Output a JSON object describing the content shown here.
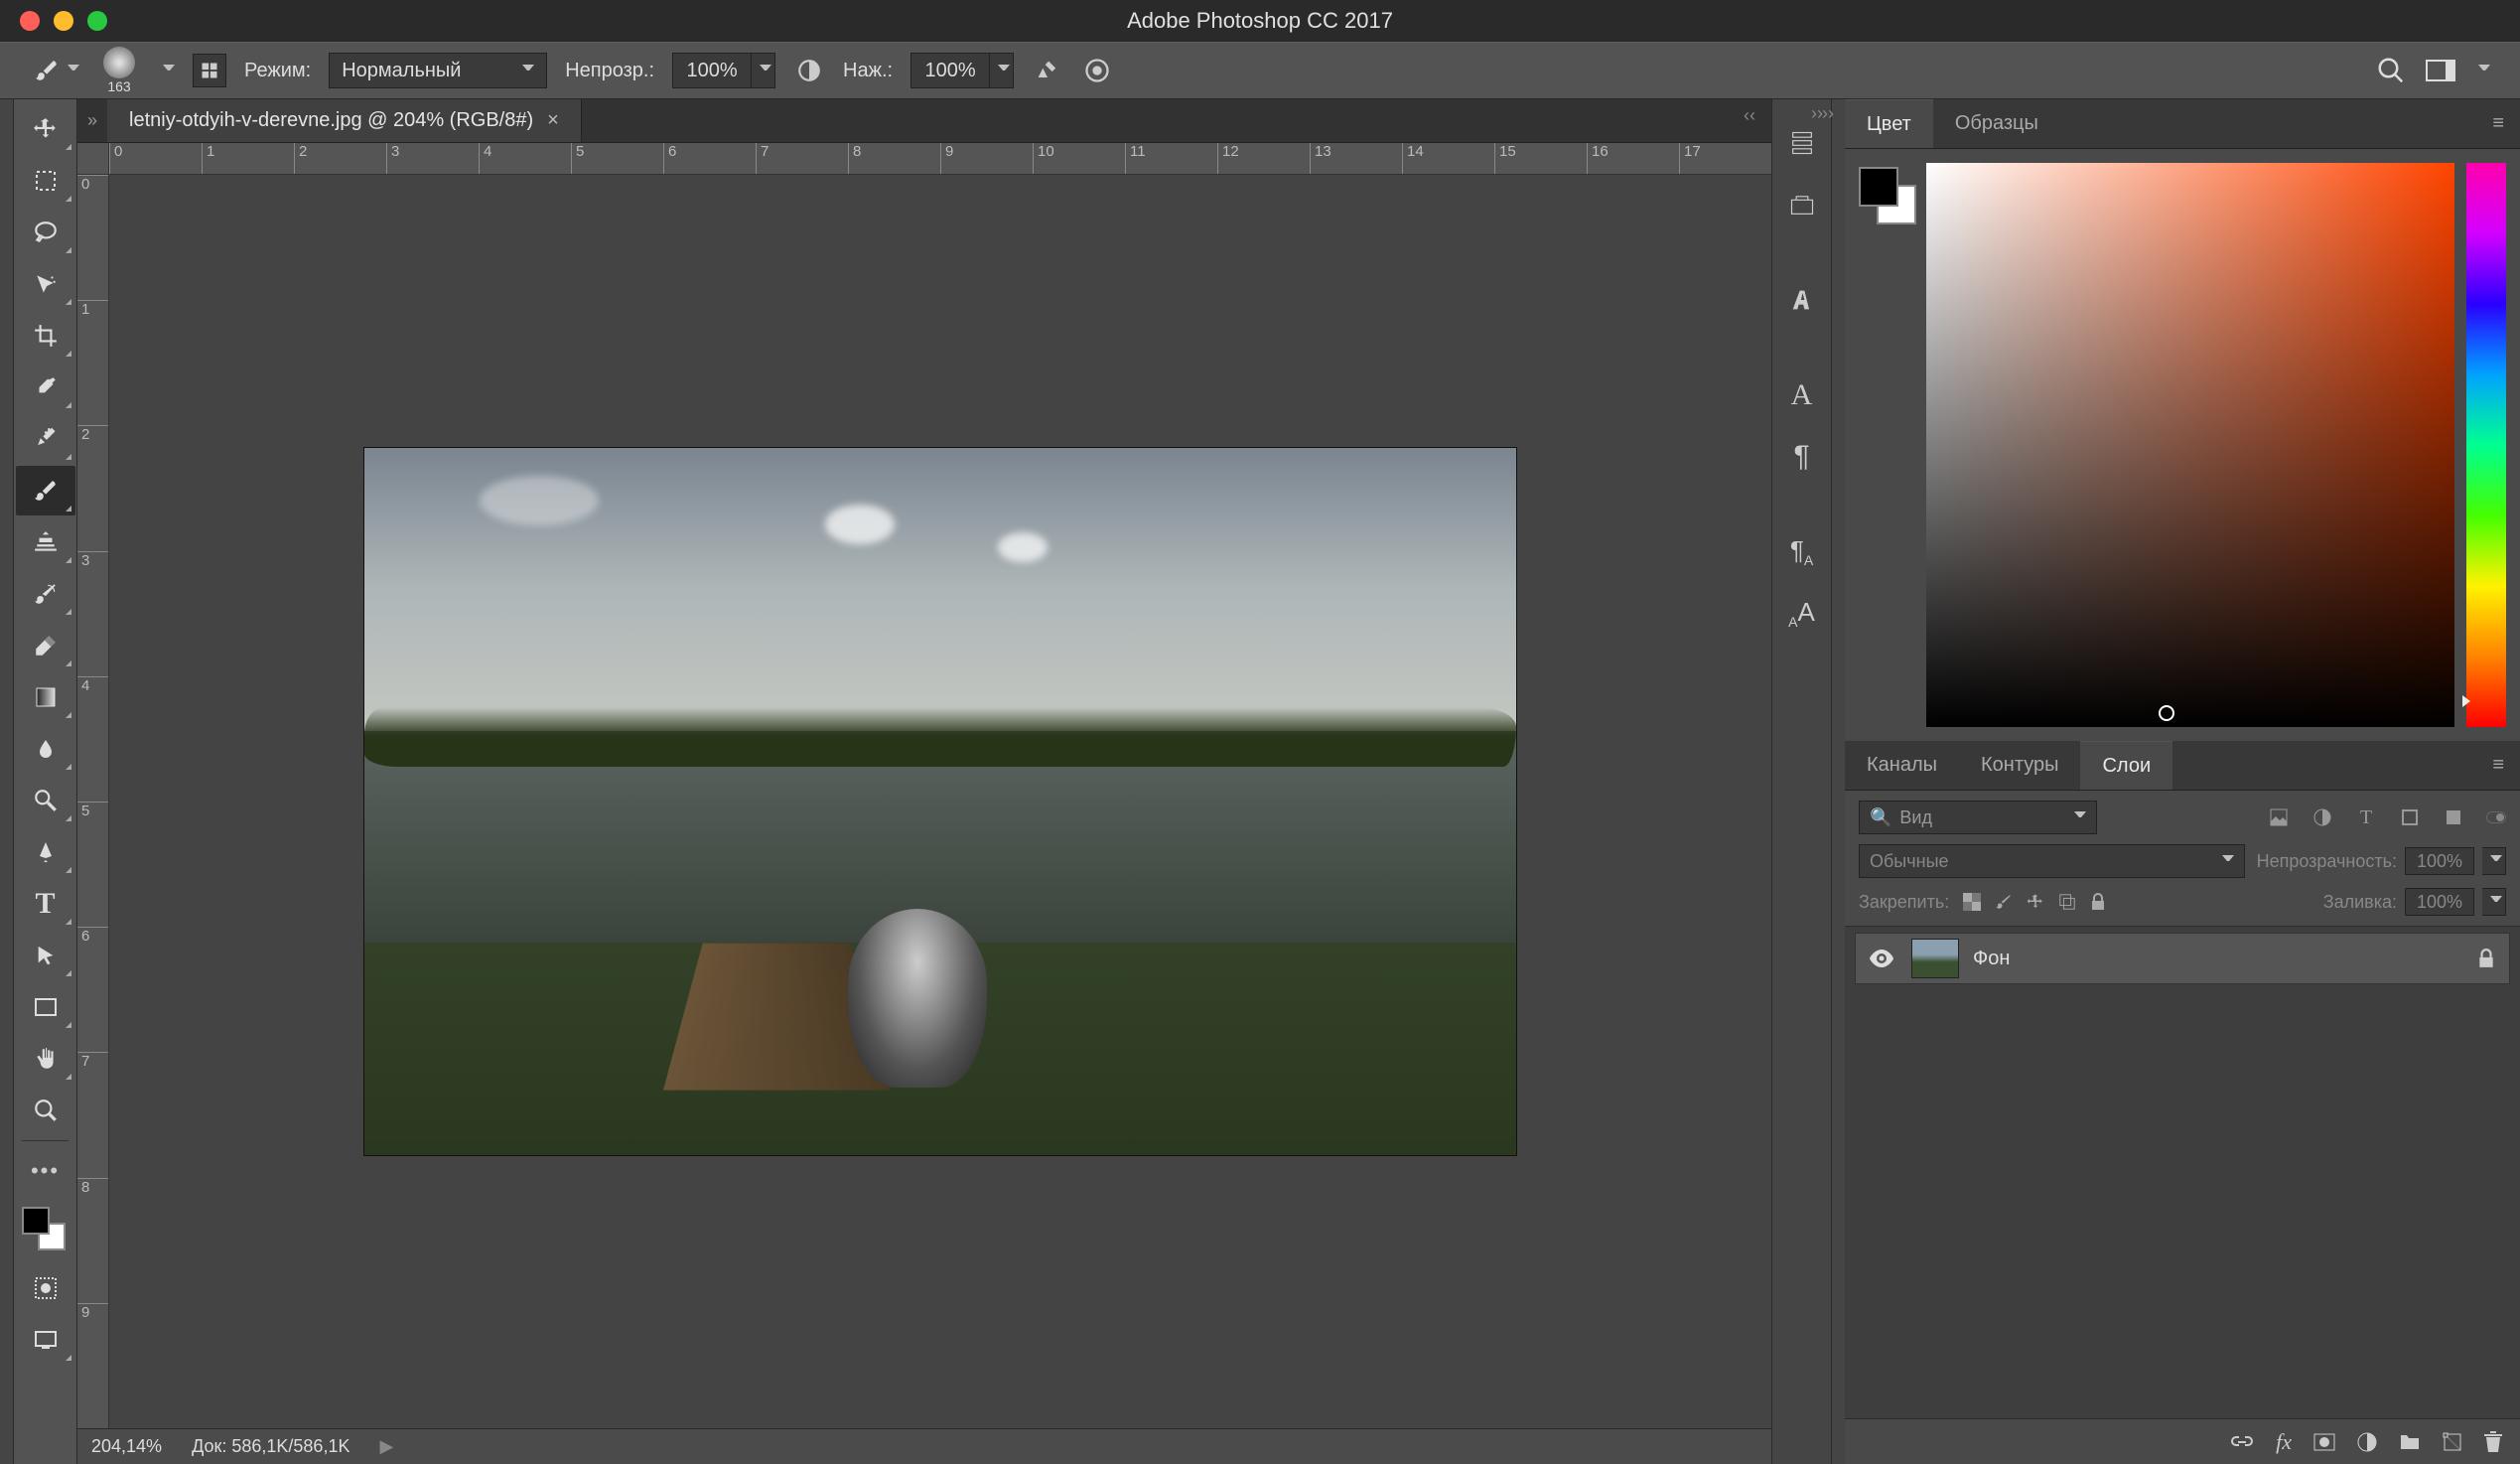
{
  "app_title": "Adobe Photoshop CC 2017",
  "options_bar": {
    "brush_size": "163",
    "mode_label": "Режим:",
    "mode_value": "Нормальный",
    "opacity_label": "Непрозр.:",
    "opacity_value": "100%",
    "flow_label": "Наж.:",
    "flow_value": "100%"
  },
  "document": {
    "tab_title": "letniy-otdyih-v-derevne.jpg @ 204% (RGB/8#)",
    "zoom": "204,14%",
    "doc_info_label": "Док:",
    "doc_info_value": "586,1K/586,1K"
  },
  "ruler_h": [
    "0",
    "1",
    "2",
    "3",
    "4",
    "5",
    "6",
    "7",
    "8",
    "9",
    "10",
    "11",
    "12",
    "13",
    "14",
    "15",
    "16",
    "17"
  ],
  "ruler_v": [
    "0",
    "1",
    "2",
    "3",
    "4",
    "5",
    "6",
    "7",
    "8",
    "9"
  ],
  "color_panel": {
    "tab_color": "Цвет",
    "tab_swatches": "Образцы"
  },
  "layers_panel": {
    "tab_channels": "Каналы",
    "tab_paths": "Контуры",
    "tab_layers": "Слои",
    "kind_placeholder": "Вид",
    "blend_mode": "Обычные",
    "opacity_label": "Непрозрачность:",
    "opacity_value": "100%",
    "lock_label": "Закрепить:",
    "fill_label": "Заливка:",
    "fill_value": "100%",
    "layer_name": "Фон"
  }
}
